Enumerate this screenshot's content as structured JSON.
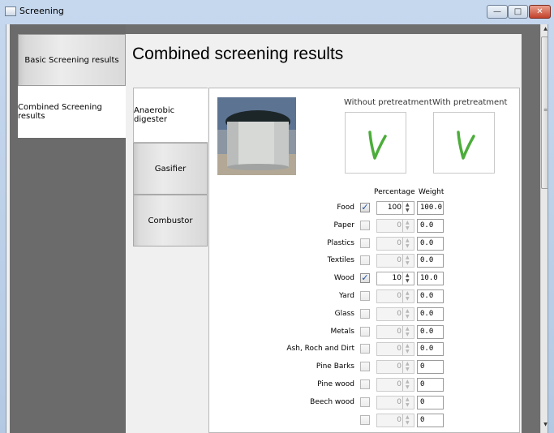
{
  "window": {
    "title": "Screening",
    "controls": {
      "minimize": "—",
      "maximize": "□",
      "close": "✕"
    }
  },
  "left_tabs": [
    {
      "label": "Basic Screening results",
      "active": false
    },
    {
      "label": "Combined Screening results",
      "active": true
    }
  ],
  "main": {
    "title": "Combined screening results"
  },
  "reactor_tabs": [
    {
      "label": "Anaerobic digester",
      "active": true
    },
    {
      "label": "Gasifier",
      "active": false
    },
    {
      "label": "Combustor",
      "active": false
    }
  ],
  "results": {
    "without_label": "Without pretreatment",
    "with_label": "With pretreatment",
    "without_status": "check",
    "with_status": "check",
    "check_color": "#4cad3a"
  },
  "table": {
    "col_percentage": "Percentage",
    "col_weight": "Weight",
    "rows": [
      {
        "label": "Food",
        "checked": true,
        "percentage": "100",
        "weight": "100.0"
      },
      {
        "label": "Paper",
        "checked": false,
        "percentage": "0",
        "weight": "0.0"
      },
      {
        "label": "Plastics",
        "checked": false,
        "percentage": "0",
        "weight": "0.0"
      },
      {
        "label": "Textiles",
        "checked": false,
        "percentage": "0",
        "weight": "0.0"
      },
      {
        "label": "Wood",
        "checked": true,
        "percentage": "10",
        "weight": "10.0"
      },
      {
        "label": "Yard",
        "checked": false,
        "percentage": "0",
        "weight": "0.0"
      },
      {
        "label": "Glass",
        "checked": false,
        "percentage": "0",
        "weight": "0.0"
      },
      {
        "label": "Metals",
        "checked": false,
        "percentage": "0",
        "weight": "0.0"
      },
      {
        "label": "Ash, Roch and Dirt",
        "checked": false,
        "percentage": "0",
        "weight": "0.0"
      },
      {
        "label": "Pine Barks",
        "checked": false,
        "percentage": "0",
        "weight": "0"
      },
      {
        "label": "Pine wood",
        "checked": false,
        "percentage": "0",
        "weight": "0"
      },
      {
        "label": "Beech wood",
        "checked": false,
        "percentage": "0",
        "weight": "0"
      },
      {
        "label": "",
        "checked": false,
        "percentage": "0",
        "weight": "0"
      }
    ]
  },
  "icons": {
    "app": "window-icon",
    "check": "check-mark-icon",
    "spin_up": "▲",
    "spin_down": "▼",
    "scroll_up": "▲",
    "scroll_down": "▼",
    "scroll_grip": "≡"
  }
}
